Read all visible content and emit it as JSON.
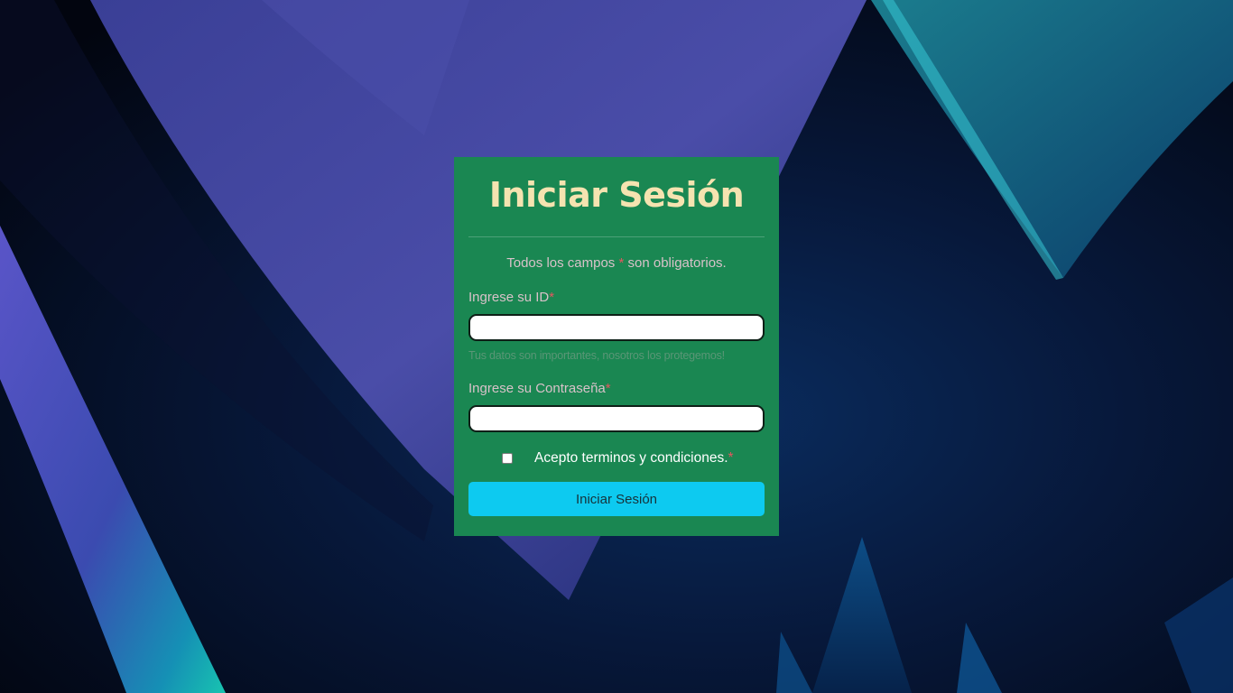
{
  "login": {
    "title": "Iniciar Sesión",
    "required_note_prefix": "Todos los campos ",
    "required_star": "*",
    "required_note_suffix": " son obligatorios.",
    "id_label": "Ingrese su ID",
    "id_value": "",
    "id_hint": "Tus datos son importantes, nosotros los protegemos!",
    "password_label": "Ingrese su Contraseña",
    "password_value": "",
    "terms_label": "Acepto terminos y condiciones.",
    "terms_checked": false,
    "submit_label": "Iniciar Sesión"
  },
  "colors": {
    "card_background": "#1a8752",
    "title": "#f5e3b0",
    "required_star": "#e4575f",
    "submit_button": "#0dcaf0"
  }
}
